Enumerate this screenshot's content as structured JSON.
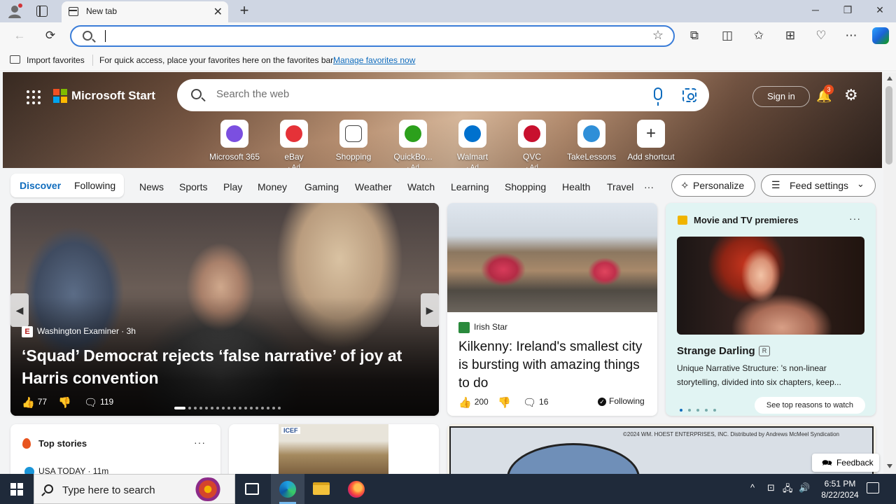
{
  "browser": {
    "tab_title": "New tab",
    "tab_close": "✕",
    "new_tab": "+",
    "window": {
      "minimize": "─",
      "restore": "❐",
      "close": "✕"
    },
    "address_value": "",
    "toolbar_icons": [
      "back-icon",
      "refresh-icon",
      "favorite-star-icon",
      "extensions-icon",
      "split-screen-icon",
      "favorites-icon",
      "collections-icon",
      "browser-essentials-icon",
      "more-icon",
      "copilot-icon"
    ],
    "back": "←",
    "refresh": "⟳",
    "star": "☆",
    "extensions": "⧉",
    "split": "◫",
    "favorites": "✩",
    "collections": "⊞",
    "essentials": "♡",
    "more": "⋯"
  },
  "favbar": {
    "import_label": "Import favorites",
    "message": "For quick access, place your favorites here on the favorites bar.",
    "manage_link": "Manage favorites now"
  },
  "start": {
    "brand": "Microsoft Start",
    "logo_colors": [
      "#f25022",
      "#7fba00",
      "#00a4ef",
      "#ffb900"
    ],
    "search_placeholder": "Search the web",
    "sign_in": "Sign in",
    "notifications_count": "3",
    "bell": "🔔",
    "gear": "⚙",
    "shortcuts": [
      {
        "label": "Microsoft 365",
        "ad": "",
        "color": "#7b4fe0"
      },
      {
        "label": "eBay",
        "ad": "· Ad",
        "color": "#e53238"
      },
      {
        "label": "Shopping",
        "ad": "",
        "color": "#ffffff"
      },
      {
        "label": "QuickBo...",
        "ad": "· Ad",
        "color": "#2ca01c"
      },
      {
        "label": "Walmart",
        "ad": "· Ad",
        "color": "#0071ce"
      },
      {
        "label": "QVC",
        "ad": "· Ad",
        "color": "#c8102e"
      },
      {
        "label": "TakeLessons",
        "ad": "",
        "color": "#2f8fd8"
      },
      {
        "label": "Add shortcut",
        "ad": "",
        "color": "#ffffff"
      }
    ]
  },
  "nav": {
    "discover": "Discover",
    "following": "Following",
    "items": [
      "News",
      "Sports",
      "Play",
      "Money",
      "Gaming",
      "Weather",
      "Watch",
      "Learning",
      "Shopping",
      "Health",
      "Travel"
    ],
    "more": "···",
    "personalize": "Personalize",
    "feed_settings": "Feed settings"
  },
  "hero": {
    "source": "Washington Examiner · 3h",
    "title": "‘Squad’ Democrat rejects ‘false narrative’ of joy at Harris convention",
    "likes": "77",
    "comments": "119",
    "slides": 18,
    "active_slide": 0
  },
  "story2": {
    "source": "Irish Star",
    "title": "Kilkenny: Ireland's smallest city is bursting with amazing things to do",
    "likes": "200",
    "comments": "16",
    "following": "Following"
  },
  "movie": {
    "header": "Movie and TV premieres",
    "more": "···",
    "title": "Strange Darling",
    "rating": "R",
    "description": "Unique Narrative Structure: 's non-linear storytelling, divided into six chapters, keep...",
    "reasons": "See top reasons to watch",
    "slides": 5,
    "active_slide": 0
  },
  "top_stories": {
    "header": "Top stories",
    "more": "···",
    "first_source": "USA TODAY · 11m"
  },
  "icef": {
    "logo": "ICEF"
  },
  "comic": {
    "credit": "©2024 WM. HOEST ENTERPRISES, INC. Distributed by Andrews McMeel Syndication"
  },
  "feedback": "Feedback",
  "taskbar": {
    "search_placeholder": "Type here to search",
    "time": "6:51 PM",
    "date": "8/22/2024",
    "tray_up": "^",
    "tray_icons": [
      "⊡",
      "🖧",
      "🔊"
    ]
  }
}
